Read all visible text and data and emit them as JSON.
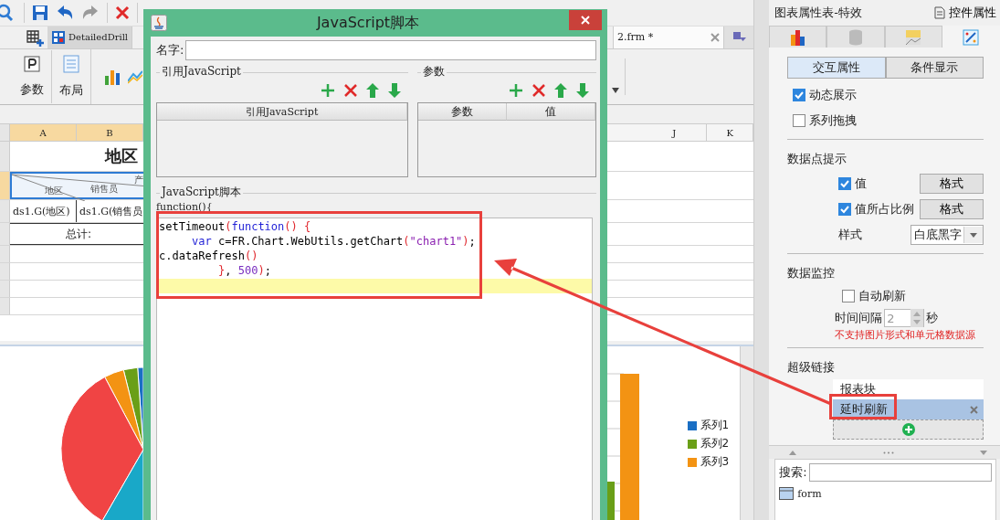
{
  "doc_tabs": [
    {
      "label": "DetailedDrill",
      "selected": false
    },
    {
      "label": "2.frm *",
      "selected": true
    }
  ],
  "ribbon": [
    {
      "label": "参数",
      "kind": "param"
    },
    {
      "label": "布局",
      "kind": "layout"
    }
  ],
  "sheet": {
    "columns": [
      "A",
      "B",
      "J",
      "K"
    ],
    "title": "地区",
    "header_labels": {
      "top": "产",
      "left": "地区",
      "middle": "销售员"
    },
    "cells": [
      "ds1.G(地区)",
      "ds1.G(销售员"
    ],
    "total": "总计:"
  },
  "chart": {
    "legend": [
      {
        "label": "系列1",
        "color": "#1a6fc4"
      },
      {
        "label": "系列2",
        "color": "#6a9f17"
      },
      {
        "label": "系列3",
        "color": "#f39313"
      }
    ]
  },
  "dialog": {
    "title": "JavaScript脚本",
    "name_label": "名字:",
    "refs": {
      "title": "引用JavaScript",
      "column": "引用JavaScript"
    },
    "params": {
      "title": "参数",
      "columns": [
        "参数",
        "值"
      ]
    },
    "script": {
      "title": "JavaScript脚本",
      "header": "function(){",
      "lines": [
        [
          {
            "text": "setTimeout",
            "kind": "plain"
          },
          {
            "text": "(",
            "kind": "paren"
          },
          {
            "text": "function",
            "kind": "keyword"
          },
          {
            "text": "() {",
            "kind": "paren"
          }
        ],
        [
          {
            "text": "     var",
            "kind": "keyword"
          },
          {
            "text": " c=FR.Chart.WebUtils.getChart",
            "kind": "plain"
          },
          {
            "text": "(",
            "kind": "paren"
          },
          {
            "text": "\"chart1\"",
            "kind": "string"
          },
          {
            "text": ")",
            "kind": "paren"
          },
          {
            "text": ";",
            "kind": "plain"
          }
        ],
        [
          {
            "text": "c.dataRefresh",
            "kind": "plain"
          },
          {
            "text": "()",
            "kind": "paren"
          }
        ],
        [
          {
            "text": "         }",
            "kind": "paren"
          },
          {
            "text": ", ",
            "kind": "plain"
          },
          {
            "text": "500",
            "kind": "number"
          },
          {
            "text": ")",
            "kind": "paren"
          },
          {
            "text": ";",
            "kind": "plain"
          }
        ]
      ]
    }
  },
  "panel": {
    "title": "图表属性表-特效",
    "widget_button": "控件属性",
    "icon_tabs": [
      {
        "kind": "chart",
        "selected": false
      },
      {
        "kind": "data",
        "selected": false
      },
      {
        "kind": "label",
        "selected": false
      },
      {
        "kind": "effects",
        "selected": true
      }
    ],
    "sub_tabs": [
      {
        "label": "交互属性",
        "selected": true
      },
      {
        "label": "条件显示",
        "selected": false
      }
    ],
    "options": [
      {
        "label": "动态展示",
        "checked": true
      },
      {
        "label": "系列拖拽",
        "checked": false
      }
    ],
    "tooltip": {
      "title": "数据点提示",
      "rows": [
        {
          "label": "值",
          "checked": true,
          "button": "格式"
        },
        {
          "label": "值所占比例",
          "checked": true,
          "button": "格式"
        }
      ],
      "style_label": "样式",
      "style_value": "白底黑字"
    },
    "monitor": {
      "title": "数据监控",
      "auto_refresh": {
        "label": "自动刷新",
        "checked": false
      },
      "interval_label": "时间间隔",
      "interval_value": "2",
      "interval_disabled": true,
      "unit": "秒",
      "warning": "不支持图片形式和单元格数据源"
    },
    "hyperlinks": {
      "title": "超级链接",
      "items": [
        {
          "label": "报表块",
          "selected": false
        },
        {
          "label": "延时刷新",
          "selected": true
        }
      ]
    },
    "search": {
      "label": "搜索:",
      "tree": [
        {
          "label": "form"
        }
      ]
    }
  }
}
